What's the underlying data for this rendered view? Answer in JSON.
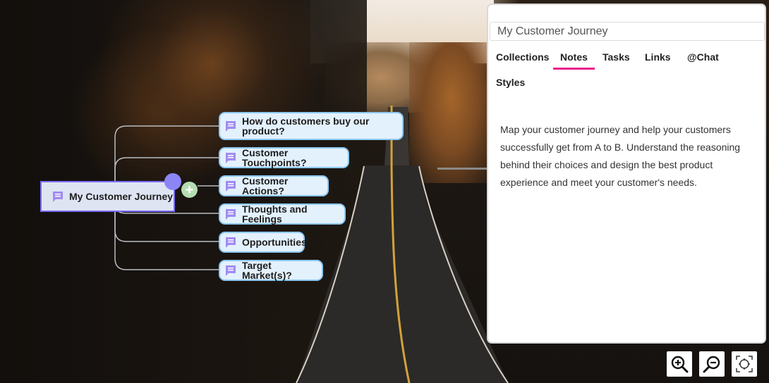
{
  "mindmap": {
    "root": {
      "label": "My Customer Journey",
      "icon": "note-icon"
    },
    "add_child_label": "+",
    "children": [
      {
        "label": "How do customers buy our product?",
        "icon": "note-icon"
      },
      {
        "label": "Customer Touchpoints?",
        "icon": "note-icon"
      },
      {
        "label": "Customer Actions?",
        "icon": "note-icon"
      },
      {
        "label": "Thoughts and Feelings",
        "icon": "note-icon"
      },
      {
        "label": "Opportunities",
        "icon": "note-icon"
      },
      {
        "label": "Target Market(s)?",
        "icon": "note-icon"
      }
    ]
  },
  "panel": {
    "title_value": "My Customer Journey",
    "tabs": [
      {
        "label": "Collections",
        "active": false
      },
      {
        "label": "Notes",
        "active": true
      },
      {
        "label": "Tasks",
        "active": false
      },
      {
        "label": "Links",
        "active": false
      },
      {
        "label": "@Chat",
        "active": false
      },
      {
        "label": "Styles",
        "active": false
      }
    ],
    "notes_text": "Map your customer journey and help your customers successfully get from A to B. Understand the reasoning behind their choices and design the best product experience and meet your customer's needs."
  },
  "zoom_controls": [
    {
      "name": "zoom-in",
      "icon": "zoom-in-icon"
    },
    {
      "name": "zoom-out",
      "icon": "zoom-out-icon"
    },
    {
      "name": "fit-to-screen",
      "icon": "focus-center-icon"
    }
  ],
  "colors": {
    "accent_tab": "#e91e8c",
    "root_border": "#7b6cf6",
    "node_border": "#8cc8f2",
    "node_bg": "#e3f1fd",
    "add_button": "#b4deb2",
    "note_icon": "#a18cf2"
  }
}
